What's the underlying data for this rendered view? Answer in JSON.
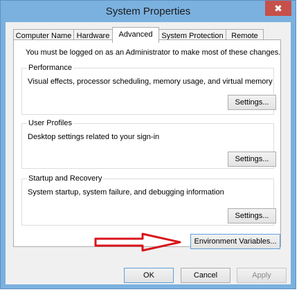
{
  "window": {
    "title": "System Properties",
    "close_glyph": "✖"
  },
  "tabs": [
    {
      "label": "Computer Name"
    },
    {
      "label": "Hardware"
    },
    {
      "label": "Advanced"
    },
    {
      "label": "System Protection"
    },
    {
      "label": "Remote"
    }
  ],
  "active_tab": "Advanced",
  "notice": "You must be logged on as an Administrator to make most of these changes.",
  "groups": {
    "performance": {
      "title": "Performance",
      "desc": "Visual effects, processor scheduling, memory usage, and virtual memory",
      "button": "Settings..."
    },
    "profiles": {
      "title": "User Profiles",
      "desc": "Desktop settings related to your sign-in",
      "button": "Settings..."
    },
    "startup": {
      "title": "Startup and Recovery",
      "desc": "System startup, system failure, and debugging information",
      "button": "Settings..."
    }
  },
  "env_button": "Environment Variables...",
  "footer": {
    "ok": "OK",
    "cancel": "Cancel",
    "apply": "Apply"
  },
  "colors": {
    "frame": "#7bb1df",
    "close": "#c7504b",
    "arrow": "#d9141b"
  }
}
